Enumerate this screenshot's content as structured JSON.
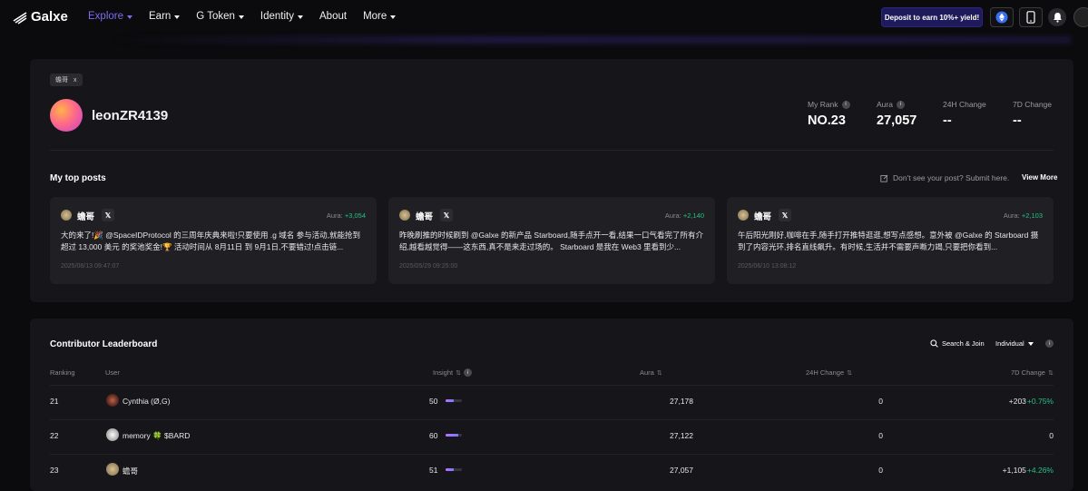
{
  "nav": {
    "logo": "Galxe",
    "menu": [
      {
        "label": "Explore",
        "active": true,
        "dropdown": true
      },
      {
        "label": "Earn",
        "active": false,
        "dropdown": true
      },
      {
        "label": "G Token",
        "active": false,
        "dropdown": true
      },
      {
        "label": "Identity",
        "active": false,
        "dropdown": true
      },
      {
        "label": "About",
        "active": false,
        "dropdown": false
      },
      {
        "label": "More",
        "active": false,
        "dropdown": true
      }
    ],
    "deposit_label": "Deposit to earn 10%+ yield!",
    "icons": [
      "ethereum-icon",
      "phone-icon",
      "bell-icon"
    ]
  },
  "profile": {
    "tag": "蟾哥",
    "tag_x": "x",
    "username": "leonZR4139",
    "stats": [
      {
        "label": "My Rank",
        "value": "NO.23",
        "info": true
      },
      {
        "label": "Aura",
        "value": "27,057",
        "info": true
      },
      {
        "label": "24H Change",
        "value": "--",
        "info": false
      },
      {
        "label": "7D Change",
        "value": "--",
        "info": false
      }
    ]
  },
  "posts_section": {
    "title": "My top posts",
    "submit_text": "Don't see your post? Submit here.",
    "view_more": "View More",
    "posts": [
      {
        "author": "蟾哥",
        "aura_label": "Aura:",
        "aura_value": "+3,054",
        "text": "大的来了!🎉 @SpaceIDProtocol 的三周年庆典来啦!只要使用 .g 域名 参与活动,就能抢到超过 13,000 美元 的奖池奖金!🏆 活动时间从 8月11日 到 9月1日,不要错过!点击链...",
        "date": "2025/08/13 09:47:07"
      },
      {
        "author": "蟾哥",
        "aura_label": "Aura:",
        "aura_value": "+2,140",
        "text": "昨晚刷推的时候刷到 @Galxe 的新产品 Starboard,随手点开一看,结果一口气看完了所有介绍,越看越觉得——这东西,真不是来走过场的。 Starboard 是我在 Web3 里看到少...",
        "date": "2025/05/29 09:25:00"
      },
      {
        "author": "蟾哥",
        "aura_label": "Aura:",
        "aura_value": "+2,103",
        "text": "午后阳光刚好,咖啡在手,随手打开推特逛逛,想写点感想。意外被 @Galxe 的 Starboard 摄到了内容光环,排名直线飙升。有时候,生活并不需要声嘶力竭,只要把你看到...",
        "date": "2025/06/10 13:08:12"
      }
    ]
  },
  "leaderboard": {
    "title": "Contributor Leaderboard",
    "search_label": "Search & Join",
    "filter_label": "Individual",
    "columns": [
      "Ranking",
      "User",
      "Insight",
      "Aura",
      "24H Change",
      "7D Change"
    ],
    "rows": [
      {
        "rank": "21",
        "user": "Cynthia (Ø,G)",
        "insight": "50",
        "insight_pct": 0.5,
        "aura": "27,178",
        "change_24h": "0",
        "change_7d": "+203",
        "change_7d_pct": "+0.75%"
      },
      {
        "rank": "22",
        "user": "memory 🍀 $BARD",
        "insight": "60",
        "insight_pct": 0.8,
        "aura": "27,122",
        "change_24h": "0",
        "change_7d": "0",
        "change_7d_pct": ""
      },
      {
        "rank": "23",
        "user": "蟾哥",
        "insight": "51",
        "insight_pct": 0.5,
        "aura": "27,057",
        "change_24h": "0",
        "change_7d": "+1,105",
        "change_7d_pct": "+4.26%"
      }
    ]
  },
  "colors": {
    "accent": "#7b6cf2",
    "positive": "#26c281",
    "deposit_bg": "#1f1a5a"
  }
}
